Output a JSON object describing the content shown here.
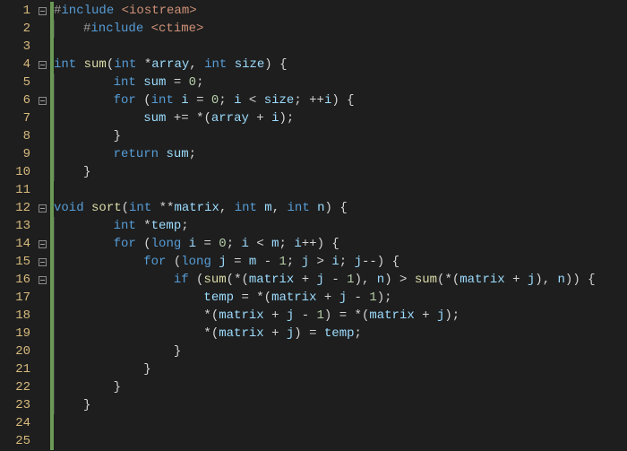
{
  "lines": [
    {
      "n": 1,
      "fold": true,
      "indent": 0,
      "tokens": [
        [
          "pp",
          "#"
        ],
        [
          "inc",
          "include "
        ],
        [
          "hdr",
          "<iostream>"
        ]
      ]
    },
    {
      "n": 2,
      "fold": false,
      "indent": 1,
      "tokens": [
        [
          "pp",
          "#"
        ],
        [
          "inc",
          "include "
        ],
        [
          "hdr",
          "<ctime>"
        ]
      ]
    },
    {
      "n": 3,
      "fold": false,
      "indent": 0,
      "tokens": []
    },
    {
      "n": 4,
      "fold": true,
      "indent": 0,
      "tokens": [
        [
          "type",
          "int "
        ],
        [
          "fn",
          "sum"
        ],
        [
          "punc",
          "("
        ],
        [
          "type",
          "int "
        ],
        [
          "op",
          "*"
        ],
        [
          "id",
          "array"
        ],
        [
          "punc",
          ", "
        ],
        [
          "type",
          "int "
        ],
        [
          "id",
          "size"
        ],
        [
          "punc",
          ") {"
        ]
      ]
    },
    {
      "n": 5,
      "fold": false,
      "indent": 1,
      "tokens": [
        [
          "txt",
          "    "
        ],
        [
          "type",
          "int "
        ],
        [
          "id",
          "sum"
        ],
        [
          "txt",
          " "
        ],
        [
          "op",
          "="
        ],
        [
          "txt",
          " "
        ],
        [
          "num",
          "0"
        ],
        [
          "punc",
          ";"
        ]
      ]
    },
    {
      "n": 6,
      "fold": true,
      "indent": 1,
      "tokens": [
        [
          "txt",
          "    "
        ],
        [
          "kw",
          "for"
        ],
        [
          "txt",
          " "
        ],
        [
          "punc",
          "("
        ],
        [
          "type",
          "int "
        ],
        [
          "id",
          "i"
        ],
        [
          "txt",
          " "
        ],
        [
          "op",
          "="
        ],
        [
          "txt",
          " "
        ],
        [
          "num",
          "0"
        ],
        [
          "punc",
          "; "
        ],
        [
          "id",
          "i"
        ],
        [
          "txt",
          " "
        ],
        [
          "op",
          "<"
        ],
        [
          "txt",
          " "
        ],
        [
          "id",
          "size"
        ],
        [
          "punc",
          "; "
        ],
        [
          "op",
          "++"
        ],
        [
          "id",
          "i"
        ],
        [
          "punc",
          ") {"
        ]
      ]
    },
    {
      "n": 7,
      "fold": false,
      "indent": 1,
      "tokens": [
        [
          "txt",
          "        "
        ],
        [
          "id",
          "sum"
        ],
        [
          "txt",
          " "
        ],
        [
          "op",
          "+="
        ],
        [
          "txt",
          " "
        ],
        [
          "op",
          "*"
        ],
        [
          "punc",
          "("
        ],
        [
          "id",
          "array"
        ],
        [
          "txt",
          " "
        ],
        [
          "op",
          "+"
        ],
        [
          "txt",
          " "
        ],
        [
          "id",
          "i"
        ],
        [
          "punc",
          ");"
        ]
      ]
    },
    {
      "n": 8,
      "fold": false,
      "indent": 1,
      "tokens": [
        [
          "txt",
          "    "
        ],
        [
          "punc",
          "}"
        ]
      ]
    },
    {
      "n": 9,
      "fold": false,
      "indent": 1,
      "tokens": [
        [
          "txt",
          "    "
        ],
        [
          "kw",
          "return"
        ],
        [
          "txt",
          " "
        ],
        [
          "id",
          "sum"
        ],
        [
          "punc",
          ";"
        ]
      ]
    },
    {
      "n": 10,
      "fold": false,
      "indent": 1,
      "tokens": [
        [
          "punc",
          "}"
        ]
      ]
    },
    {
      "n": 11,
      "fold": false,
      "indent": 0,
      "tokens": []
    },
    {
      "n": 12,
      "fold": true,
      "indent": 0,
      "tokens": [
        [
          "type",
          "void "
        ],
        [
          "fn",
          "sort"
        ],
        [
          "punc",
          "("
        ],
        [
          "type",
          "int "
        ],
        [
          "op",
          "**"
        ],
        [
          "id",
          "matrix"
        ],
        [
          "punc",
          ", "
        ],
        [
          "type",
          "int "
        ],
        [
          "id",
          "m"
        ],
        [
          "punc",
          ", "
        ],
        [
          "type",
          "int "
        ],
        [
          "id",
          "n"
        ],
        [
          "punc",
          ") {"
        ]
      ]
    },
    {
      "n": 13,
      "fold": false,
      "indent": 1,
      "tokens": [
        [
          "txt",
          "    "
        ],
        [
          "type",
          "int "
        ],
        [
          "op",
          "*"
        ],
        [
          "id",
          "temp"
        ],
        [
          "punc",
          ";"
        ]
      ]
    },
    {
      "n": 14,
      "fold": true,
      "indent": 1,
      "tokens": [
        [
          "txt",
          "    "
        ],
        [
          "kw",
          "for"
        ],
        [
          "txt",
          " "
        ],
        [
          "punc",
          "("
        ],
        [
          "type",
          "long "
        ],
        [
          "id",
          "i"
        ],
        [
          "txt",
          " "
        ],
        [
          "op",
          "="
        ],
        [
          "txt",
          " "
        ],
        [
          "num",
          "0"
        ],
        [
          "punc",
          "; "
        ],
        [
          "id",
          "i"
        ],
        [
          "txt",
          " "
        ],
        [
          "op",
          "<"
        ],
        [
          "txt",
          " "
        ],
        [
          "id",
          "m"
        ],
        [
          "punc",
          "; "
        ],
        [
          "id",
          "i"
        ],
        [
          "op",
          "++"
        ],
        [
          "punc",
          ") {"
        ]
      ]
    },
    {
      "n": 15,
      "fold": true,
      "indent": 1,
      "tokens": [
        [
          "txt",
          "        "
        ],
        [
          "kw",
          "for"
        ],
        [
          "txt",
          " "
        ],
        [
          "punc",
          "("
        ],
        [
          "type",
          "long "
        ],
        [
          "id",
          "j"
        ],
        [
          "txt",
          " "
        ],
        [
          "op",
          "="
        ],
        [
          "txt",
          " "
        ],
        [
          "id",
          "m"
        ],
        [
          "txt",
          " "
        ],
        [
          "op",
          "-"
        ],
        [
          "txt",
          " "
        ],
        [
          "num",
          "1"
        ],
        [
          "punc",
          "; "
        ],
        [
          "id",
          "j"
        ],
        [
          "txt",
          " "
        ],
        [
          "op",
          ">"
        ],
        [
          "txt",
          " "
        ],
        [
          "id",
          "i"
        ],
        [
          "punc",
          "; "
        ],
        [
          "id",
          "j"
        ],
        [
          "op",
          "--"
        ],
        [
          "punc",
          ") {"
        ]
      ]
    },
    {
      "n": 16,
      "fold": true,
      "indent": 1,
      "tokens": [
        [
          "txt",
          "            "
        ],
        [
          "kw",
          "if"
        ],
        [
          "txt",
          " "
        ],
        [
          "punc",
          "("
        ],
        [
          "fn",
          "sum"
        ],
        [
          "punc",
          "("
        ],
        [
          "op",
          "*"
        ],
        [
          "punc",
          "("
        ],
        [
          "id",
          "matrix"
        ],
        [
          "txt",
          " "
        ],
        [
          "op",
          "+"
        ],
        [
          "txt",
          " "
        ],
        [
          "id",
          "j"
        ],
        [
          "txt",
          " "
        ],
        [
          "op",
          "-"
        ],
        [
          "txt",
          " "
        ],
        [
          "num",
          "1"
        ],
        [
          "punc",
          "), "
        ],
        [
          "id",
          "n"
        ],
        [
          "punc",
          ") "
        ],
        [
          "op",
          ">"
        ],
        [
          "txt",
          " "
        ],
        [
          "fn",
          "sum"
        ],
        [
          "punc",
          "("
        ],
        [
          "op",
          "*"
        ],
        [
          "punc",
          "("
        ],
        [
          "id",
          "matrix"
        ],
        [
          "txt",
          " "
        ],
        [
          "op",
          "+"
        ],
        [
          "txt",
          " "
        ],
        [
          "id",
          "j"
        ],
        [
          "punc",
          "), "
        ],
        [
          "id",
          "n"
        ],
        [
          "punc",
          ")) {"
        ]
      ]
    },
    {
      "n": 17,
      "fold": false,
      "indent": 1,
      "tokens": [
        [
          "txt",
          "                "
        ],
        [
          "id",
          "temp"
        ],
        [
          "txt",
          " "
        ],
        [
          "op",
          "="
        ],
        [
          "txt",
          " "
        ],
        [
          "op",
          "*"
        ],
        [
          "punc",
          "("
        ],
        [
          "id",
          "matrix"
        ],
        [
          "txt",
          " "
        ],
        [
          "op",
          "+"
        ],
        [
          "txt",
          " "
        ],
        [
          "id",
          "j"
        ],
        [
          "txt",
          " "
        ],
        [
          "op",
          "-"
        ],
        [
          "txt",
          " "
        ],
        [
          "num",
          "1"
        ],
        [
          "punc",
          ");"
        ]
      ]
    },
    {
      "n": 18,
      "fold": false,
      "indent": 1,
      "tokens": [
        [
          "txt",
          "                "
        ],
        [
          "op",
          "*"
        ],
        [
          "punc",
          "("
        ],
        [
          "id",
          "matrix"
        ],
        [
          "txt",
          " "
        ],
        [
          "op",
          "+"
        ],
        [
          "txt",
          " "
        ],
        [
          "id",
          "j"
        ],
        [
          "txt",
          " "
        ],
        [
          "op",
          "-"
        ],
        [
          "txt",
          " "
        ],
        [
          "num",
          "1"
        ],
        [
          "punc",
          ") "
        ],
        [
          "op",
          "="
        ],
        [
          "txt",
          " "
        ],
        [
          "op",
          "*"
        ],
        [
          "punc",
          "("
        ],
        [
          "id",
          "matrix"
        ],
        [
          "txt",
          " "
        ],
        [
          "op",
          "+"
        ],
        [
          "txt",
          " "
        ],
        [
          "id",
          "j"
        ],
        [
          "punc",
          ");"
        ]
      ]
    },
    {
      "n": 19,
      "fold": false,
      "indent": 1,
      "tokens": [
        [
          "txt",
          "                "
        ],
        [
          "op",
          "*"
        ],
        [
          "punc",
          "("
        ],
        [
          "id",
          "matrix"
        ],
        [
          "txt",
          " "
        ],
        [
          "op",
          "+"
        ],
        [
          "txt",
          " "
        ],
        [
          "id",
          "j"
        ],
        [
          "punc",
          ") "
        ],
        [
          "op",
          "="
        ],
        [
          "txt",
          " "
        ],
        [
          "id",
          "temp"
        ],
        [
          "punc",
          ";"
        ]
      ]
    },
    {
      "n": 20,
      "fold": false,
      "indent": 1,
      "tokens": [
        [
          "txt",
          "            "
        ],
        [
          "punc",
          "}"
        ]
      ]
    },
    {
      "n": 21,
      "fold": false,
      "indent": 1,
      "tokens": [
        [
          "txt",
          "        "
        ],
        [
          "punc",
          "}"
        ]
      ]
    },
    {
      "n": 22,
      "fold": false,
      "indent": 1,
      "tokens": [
        [
          "txt",
          "    "
        ],
        [
          "punc",
          "}"
        ]
      ]
    },
    {
      "n": 23,
      "fold": false,
      "indent": 1,
      "tokens": [
        [
          "punc",
          "}"
        ]
      ]
    },
    {
      "n": 24,
      "fold": false,
      "indent": 0,
      "tokens": []
    },
    {
      "n": 25,
      "fold": false,
      "indent": 0,
      "tokens": []
    }
  ]
}
